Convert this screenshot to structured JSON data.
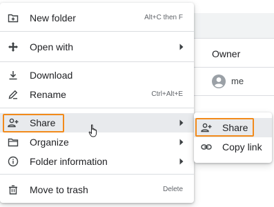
{
  "background": {
    "column_header": "Owner",
    "owner_value": "me"
  },
  "menu": {
    "items": [
      {
        "label": "New folder",
        "shortcut": "Alt+C then F",
        "icon": "new-folder-icon"
      },
      {
        "label": "Open with",
        "icon": "open-with-icon",
        "has_submenu": true
      },
      {
        "label": "Download",
        "icon": "download-icon"
      },
      {
        "label": "Rename",
        "shortcut": "Ctrl+Alt+E",
        "icon": "rename-icon"
      },
      {
        "label": "Share",
        "icon": "share-person-add-icon",
        "has_submenu": true,
        "active": true
      },
      {
        "label": "Organize",
        "icon": "folder-icon",
        "has_submenu": true
      },
      {
        "label": "Folder information",
        "icon": "info-icon",
        "has_submenu": true
      },
      {
        "label": "Move to trash",
        "shortcut": "Delete",
        "icon": "trash-icon"
      }
    ]
  },
  "submenu": {
    "items": [
      {
        "label": "Share",
        "icon": "share-person-add-icon",
        "active": true
      },
      {
        "label": "Copy link",
        "icon": "link-icon"
      }
    ]
  },
  "colors": {
    "highlight_border": "#f28a1a",
    "hover_background": "#e8eaed",
    "text": "#202124",
    "muted": "#5f6368"
  }
}
